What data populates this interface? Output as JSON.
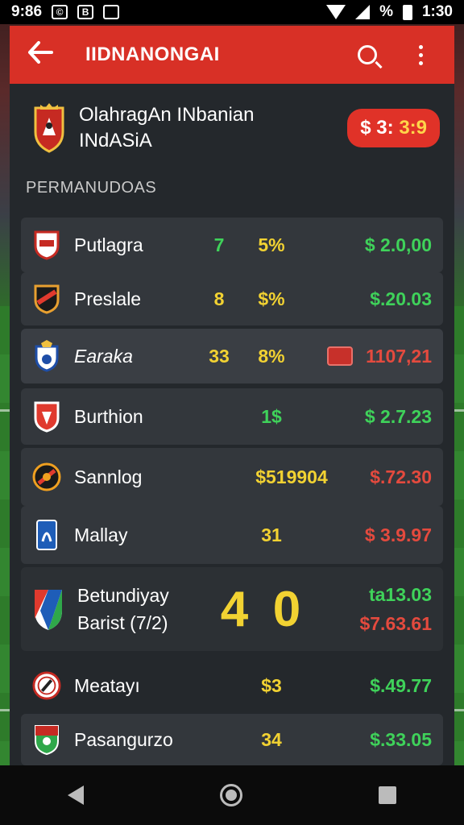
{
  "status_bar": {
    "time_left": "9:86",
    "time_right": "1:30",
    "percent": "%",
    "box1": "©",
    "box2": "B"
  },
  "app_bar": {
    "title": "IIDNANONGAI"
  },
  "header": {
    "league_name": "OlahragAn INbanian",
    "league_country": "INdASiA",
    "price_prefix": "$ 3:",
    "price_value": "3:9"
  },
  "section_title": "PERMANUDOAS",
  "rows": [
    {
      "team": "Putlagra",
      "num1": "7",
      "num2": "5%",
      "price": "$ 2.0,00",
      "num1_color": "green",
      "price_color": "green"
    },
    {
      "team": "Preslale",
      "num1": "8",
      "num2": "$%",
      "price": "$.20.03",
      "num1_color": "yellow",
      "price_color": "green"
    },
    {
      "team": "Earaka",
      "num1": "33",
      "num2": "8%",
      "price": "1107,21",
      "num1_color": "yellow",
      "price_color": "red"
    },
    {
      "team": "Burthion",
      "num1": "",
      "num2": "1$",
      "price": "$ 2.7.23",
      "num1_color": "green",
      "price_color": "green"
    },
    {
      "team": "Sannlog",
      "num1": "",
      "num2": "$519904",
      "price": "$.72.30",
      "num1_color": "yellow",
      "price_color": "red"
    },
    {
      "team": "Mallay",
      "num1": "",
      "num2": "31",
      "price": "$ 3.9.97",
      "num1_color": "yellow",
      "price_color": "red"
    },
    {
      "team_line1": "Betundiyay",
      "team_line2": "Barist (7/2)",
      "score_left": "4",
      "score_right": "0",
      "price_line1": "ta13.03",
      "price_line2": "$7.63.61"
    },
    {
      "team": "Meatayı",
      "num1": "",
      "num2": "$3",
      "price": "$.49.77",
      "num1_color": "yellow",
      "price_color": "green"
    },
    {
      "team": "Pasangurzo",
      "num1": "",
      "num2": "34",
      "price": "$.33.05",
      "num1_color": "yellow",
      "price_color": "green"
    }
  ],
  "colors": {
    "accent": "#d83026",
    "panel": "#24282c",
    "card": "#33373c",
    "green": "#3fd25a",
    "red": "#e44a3e",
    "yellow": "#f2d232"
  }
}
